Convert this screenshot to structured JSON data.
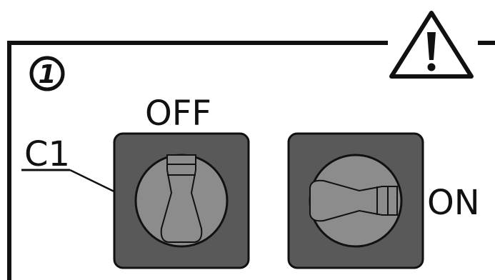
{
  "step_number": "1",
  "labels": {
    "off": "OFF",
    "on": "ON",
    "component": "C1"
  },
  "icons": {
    "warning": "warning-triangle-icon",
    "step_badge": "circled-number-icon"
  },
  "switches": [
    {
      "id": "switch-off",
      "state": "OFF",
      "handle_orientation": "vertical"
    },
    {
      "id": "switch-on",
      "state": "ON",
      "handle_orientation": "horizontal"
    }
  ],
  "colors": {
    "line": "#111111",
    "switch_body": "#595959",
    "knob": "#8c8c8c",
    "handle": "#8c8c8c",
    "background": "#ffffff"
  }
}
